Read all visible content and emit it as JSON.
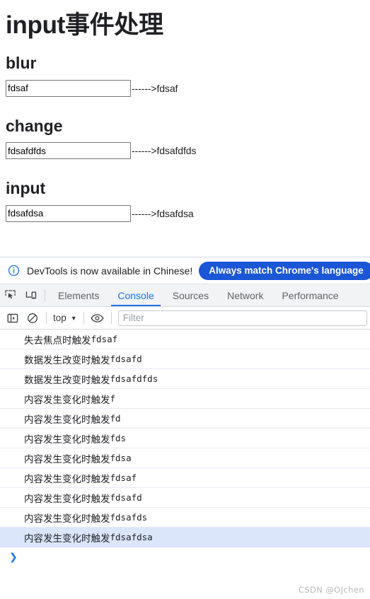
{
  "page": {
    "title": "input事件处理",
    "sections": [
      {
        "heading": "blur",
        "input_value": "fdsaf",
        "input_placeholder": "",
        "arrow": "------>",
        "mirror_value": "fdsaf"
      },
      {
        "heading": "change",
        "input_value": "fdsafdfds",
        "input_placeholder": "",
        "arrow": "------>",
        "mirror_value": "fdsafdfds"
      },
      {
        "heading": "input",
        "input_value": "fdsafdsa",
        "input_placeholder": "",
        "arrow": "------>",
        "mirror_value": "fdsafdsa"
      }
    ]
  },
  "devtools": {
    "infobar": {
      "icon": "info-circle-icon",
      "message": "DevTools is now available in Chinese!",
      "action_label": "Always match Chrome's language"
    },
    "tabbar": {
      "inspect_icon": "inspect-element-icon",
      "device_icon": "device-toolbar-icon",
      "tabs": [
        {
          "label": "Elements",
          "active": false
        },
        {
          "label": "Console",
          "active": true
        },
        {
          "label": "Sources",
          "active": false
        },
        {
          "label": "Network",
          "active": false
        },
        {
          "label": "Performance",
          "active": false
        }
      ]
    },
    "console_toolbar": {
      "sidebar_icon": "console-sidebar-icon",
      "clear_icon": "clear-console-icon",
      "context": "top",
      "context_caret": "▼",
      "eye_icon": "live-expression-eye-icon",
      "filter_placeholder": "Filter",
      "filter_value": ""
    },
    "console_messages": [
      {
        "prefix": "失去焦点时触发",
        "value": "fdsaf",
        "selected": false
      },
      {
        "prefix": "数据发生改变时触发",
        "value": "fdsafd",
        "selected": false
      },
      {
        "prefix": "数据发生改变时触发",
        "value": "fdsafdfds",
        "selected": false
      },
      {
        "prefix": "内容发生变化时触发",
        "value": "f",
        "selected": false
      },
      {
        "prefix": "内容发生变化时触发",
        "value": "fd",
        "selected": false
      },
      {
        "prefix": "内容发生变化时触发",
        "value": "fds",
        "selected": false
      },
      {
        "prefix": "内容发生变化时触发",
        "value": "fdsa",
        "selected": false
      },
      {
        "prefix": "内容发生变化时触发",
        "value": "fdsaf",
        "selected": false
      },
      {
        "prefix": "内容发生变化时触发",
        "value": "fdsafd",
        "selected": false
      },
      {
        "prefix": "内容发生变化时触发",
        "value": "fdsafds",
        "selected": false
      },
      {
        "prefix": "内容发生变化时触发",
        "value": "fdsafdsa",
        "selected": true
      }
    ],
    "prompt": {
      "caret": "❯"
    }
  },
  "watermark": "CSDN @OJchen",
  "colors": {
    "accent_blue": "#1a73e8",
    "button_blue": "#1a56d6",
    "selected_row": "#dbe6fb",
    "tabbar_bg": "#f1f3f4",
    "text": "#202124"
  }
}
